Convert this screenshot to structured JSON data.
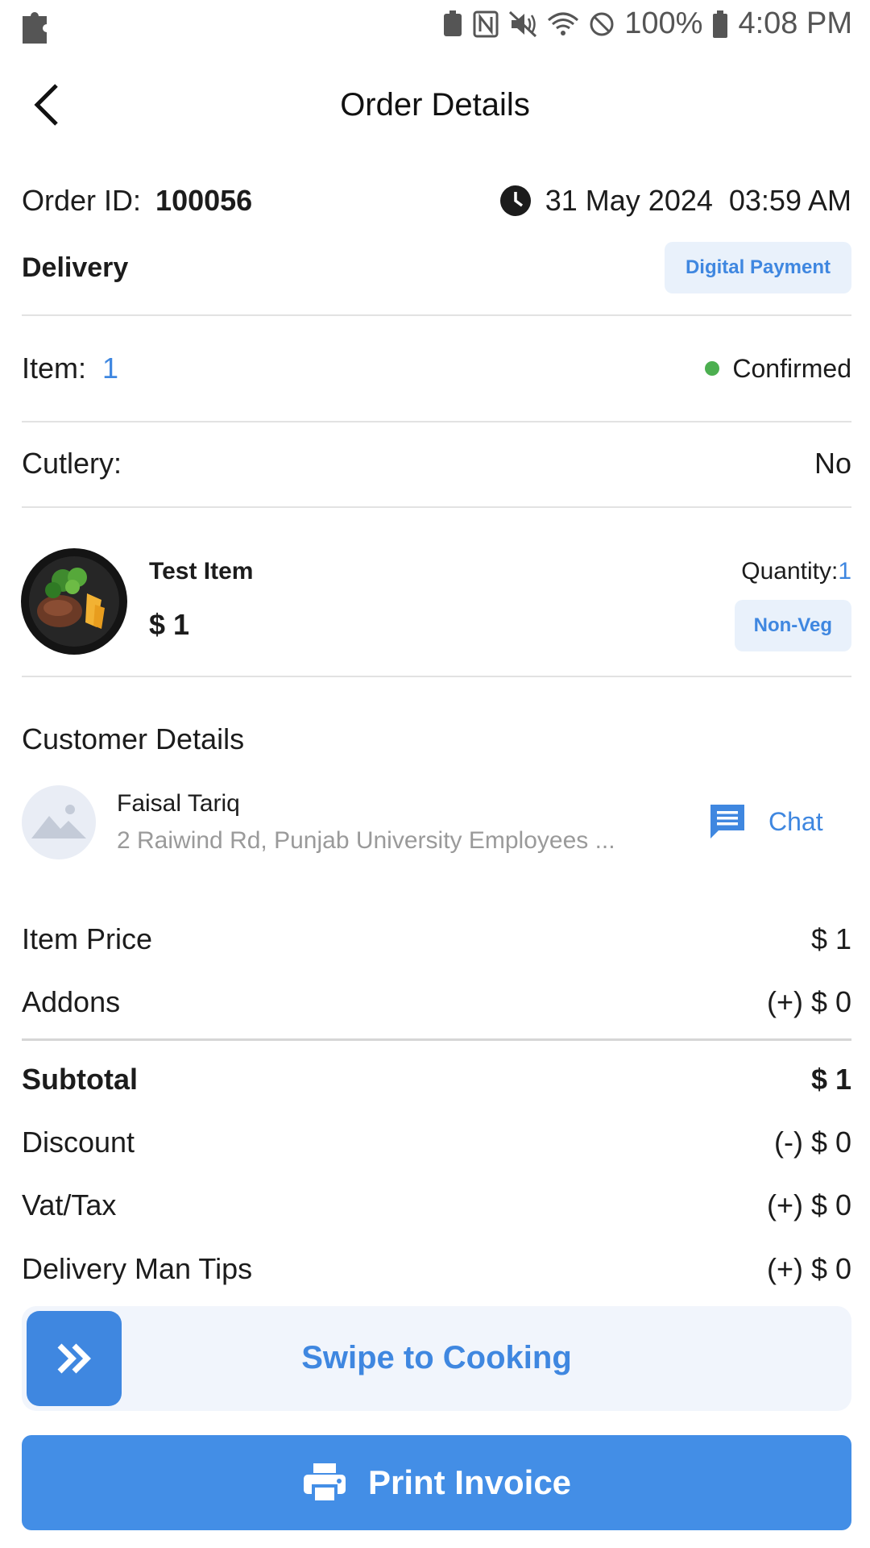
{
  "status_bar": {
    "battery": "100%",
    "time": "4:08 PM"
  },
  "header": {
    "title": "Order Details"
  },
  "order": {
    "id_label": "Order ID:",
    "id_value": "100056",
    "date": "31 May 2024",
    "time": "03:59 AM",
    "type": "Delivery",
    "payment_badge": "Digital Payment",
    "item_label": "Item:",
    "item_count": "1",
    "status": "Confirmed",
    "status_color": "#4caf50",
    "cutlery_label": "Cutlery:",
    "cutlery_value": "No"
  },
  "item": {
    "name": "Test Item",
    "price": "$ 1",
    "quantity_label": "Quantity:",
    "quantity_value": "1",
    "tag": "Non-Veg"
  },
  "customer": {
    "section_title": "Customer Details",
    "name": "Faisal Tariq",
    "address": "2 Raiwind Rd, Punjab University Employees ...",
    "chat_label": "Chat"
  },
  "summary": {
    "item_price_label": "Item Price",
    "item_price_value": "$ 1",
    "addons_label": "Addons",
    "addons_value": "(+) $ 0",
    "subtotal_label": "Subtotal",
    "subtotal_value": "$ 1",
    "discount_label": "Discount",
    "discount_value": "(-) $ 0",
    "vat_label": "Vat/Tax",
    "vat_value": "(+) $ 0",
    "tips_label": "Delivery Man Tips",
    "tips_value": "(+) $ 0"
  },
  "actions": {
    "swipe_label": "Swipe to Cooking",
    "print_label": "Print Invoice"
  },
  "colors": {
    "accent": "#3f87e0",
    "accent_light": "#e9f1fb",
    "success": "#4caf50"
  }
}
